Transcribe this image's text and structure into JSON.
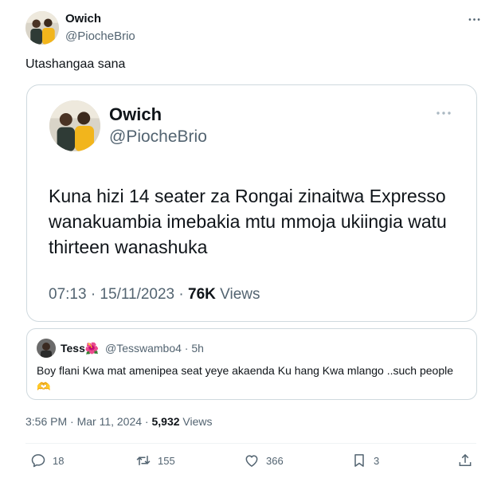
{
  "post": {
    "author_name": "Owich",
    "author_handle": "@PiocheBrio",
    "text": "Utashangaa sana",
    "timestamp": "3:56 PM · Mar 11, 2024 · ",
    "views_count": "5,932",
    "views_label": " Views"
  },
  "quoted": {
    "author_name": "Owich",
    "author_handle": "@PiocheBrio",
    "text": "Kuna hizi 14 seater za Rongai zinaitwa Expresso wanakuambia imebakia mtu mmoja ukiingia watu thirteen wanashuka",
    "timestamp": "07:13 · 15/11/2023 · ",
    "views_count": "76K",
    "views_label": " Views"
  },
  "reply": {
    "author_name": "Tess🌺",
    "author_handle": "@Tesswambo4 · 5h",
    "text": "Boy flani Kwa mat amenipea seat yeye akaenda Ku hang Kwa mlango ..such people 🫶"
  },
  "actions": {
    "replies": "18",
    "retweets": "155",
    "likes": "366",
    "bookmarks": "3"
  },
  "colors": {
    "text_primary": "#0f1419",
    "text_secondary": "#536471",
    "border": "#cfd9de"
  },
  "icons": {
    "more": "more-horizontal-icon",
    "reply": "speech-bubble-icon",
    "retweet": "retweet-arrows-icon",
    "like": "heart-icon",
    "bookmark": "bookmark-icon",
    "share": "share-upload-icon"
  }
}
